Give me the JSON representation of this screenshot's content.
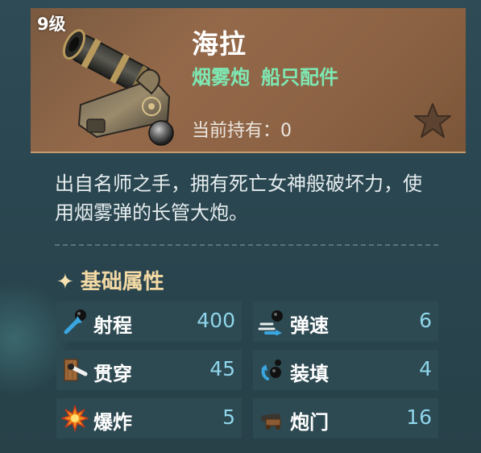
{
  "item": {
    "level": "9级",
    "name": "海拉",
    "type": "烟雾炮",
    "category": "船只配件",
    "owned_label": "当前持有：",
    "owned_count": "0",
    "description": "出自名师之手，拥有死亡女神般破坏力，使用烟雾弹的长管大炮。"
  },
  "section": {
    "spark": "✦",
    "title": "基础属性"
  },
  "stats": [
    {
      "label": "射程",
      "value": "400",
      "icon": "range-icon"
    },
    {
      "label": "弹速",
      "value": "6",
      "icon": "shell-speed-icon"
    },
    {
      "label": "贯穿",
      "value": "45",
      "icon": "penetration-icon"
    },
    {
      "label": "装填",
      "value": "4",
      "icon": "reload-icon"
    },
    {
      "label": "爆炸",
      "value": "5",
      "icon": "explosion-icon"
    },
    {
      "label": "炮门",
      "value": "16",
      "icon": "cannon-port-icon"
    }
  ],
  "colors": {
    "header_bg": "#8c6244",
    "type_text": "#7ee8b3",
    "stat_value": "#8fd6ec",
    "section_title": "#f3d9a4"
  }
}
